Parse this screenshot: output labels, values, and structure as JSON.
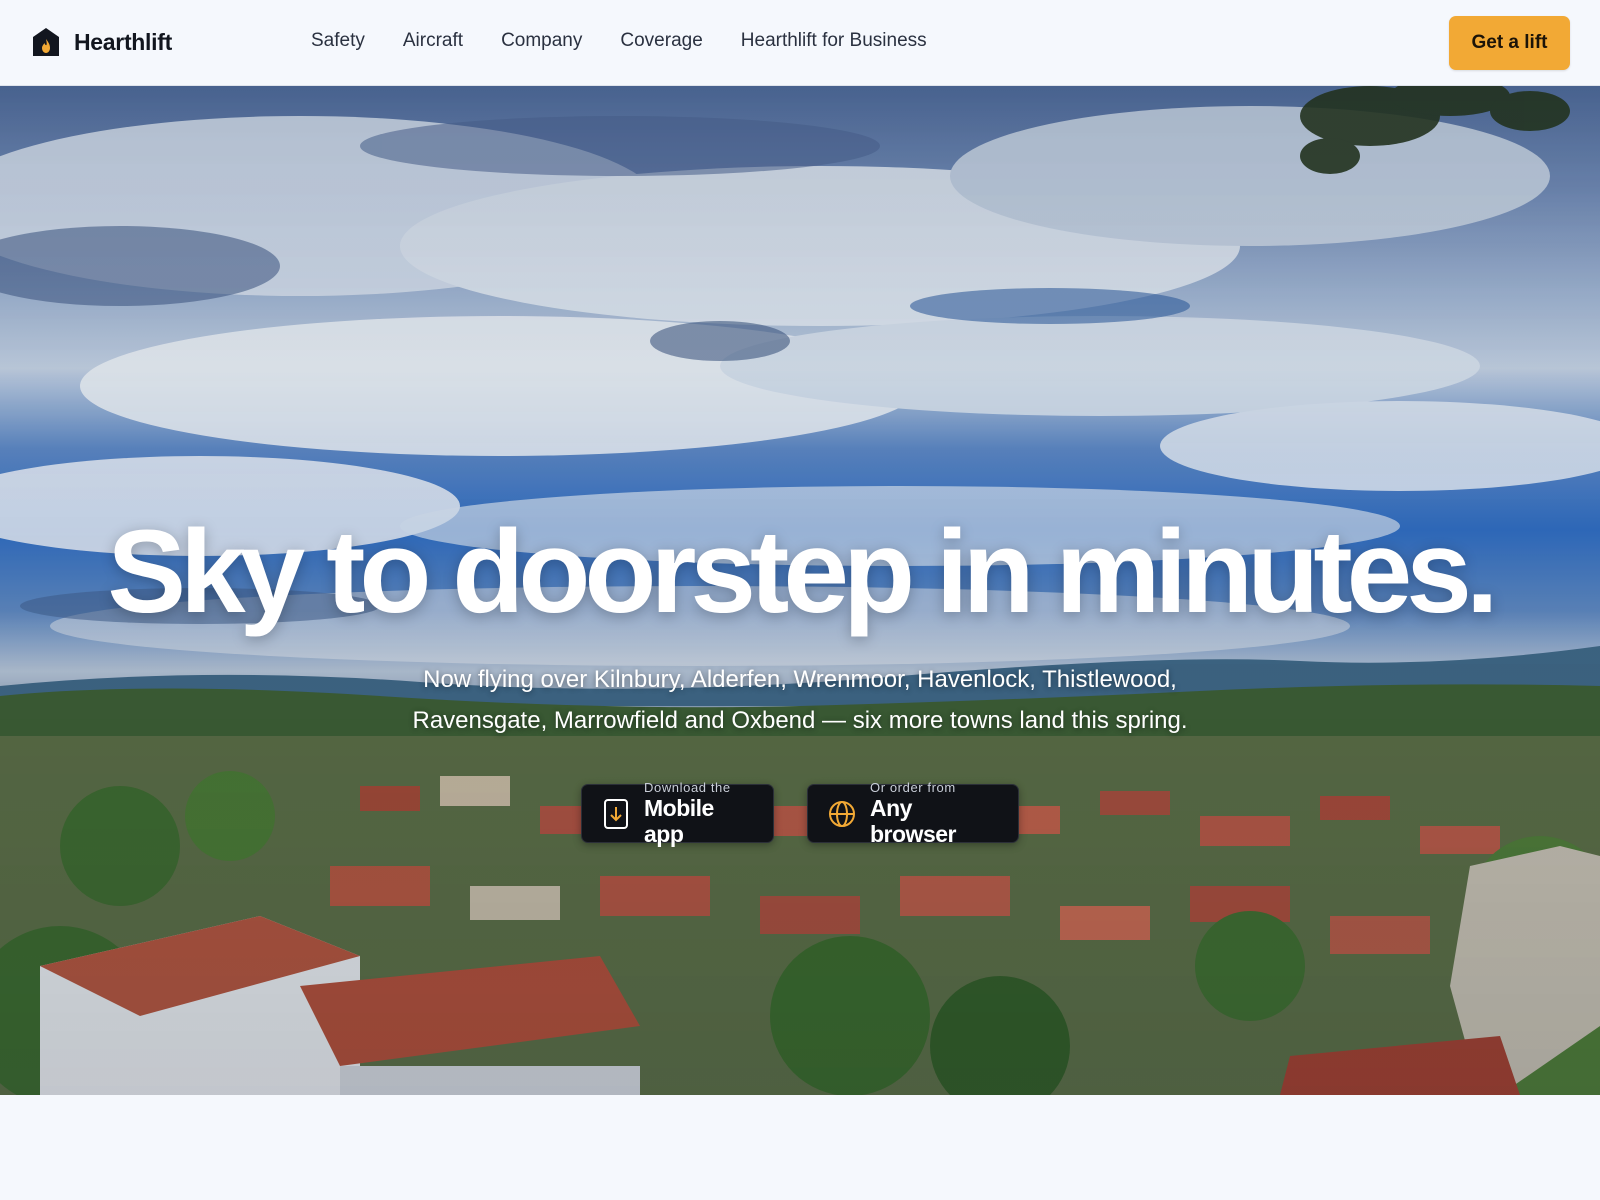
{
  "brand": {
    "name": "Hearthlift",
    "icon": "house-flame-icon"
  },
  "nav": {
    "links": [
      {
        "label": "Safety"
      },
      {
        "label": "Aircraft"
      },
      {
        "label": "Company"
      },
      {
        "label": "Coverage"
      },
      {
        "label": "Hearthlift for Business"
      }
    ],
    "cta_label": "Get a lift"
  },
  "hero": {
    "headline": "Sky to doorstep in minutes.",
    "subline": "Now flying over Kilnbury, Alderfen, Wrenmoor, Havenlock, Thistlewood, Ravensgate, Marrowfield and Oxbend — six more towns land this spring.",
    "buttons": {
      "mobile": {
        "small": "Download the",
        "big": "Mobile app",
        "icon": "phone-download-icon"
      },
      "web": {
        "small": "Or order from",
        "big": "Any browser",
        "icon": "globe-icon"
      }
    }
  },
  "colors": {
    "accent": "#f2a935",
    "page_bg": "#f5f8fd",
    "text_dark": "#12161f",
    "button_dark": "#101217"
  }
}
